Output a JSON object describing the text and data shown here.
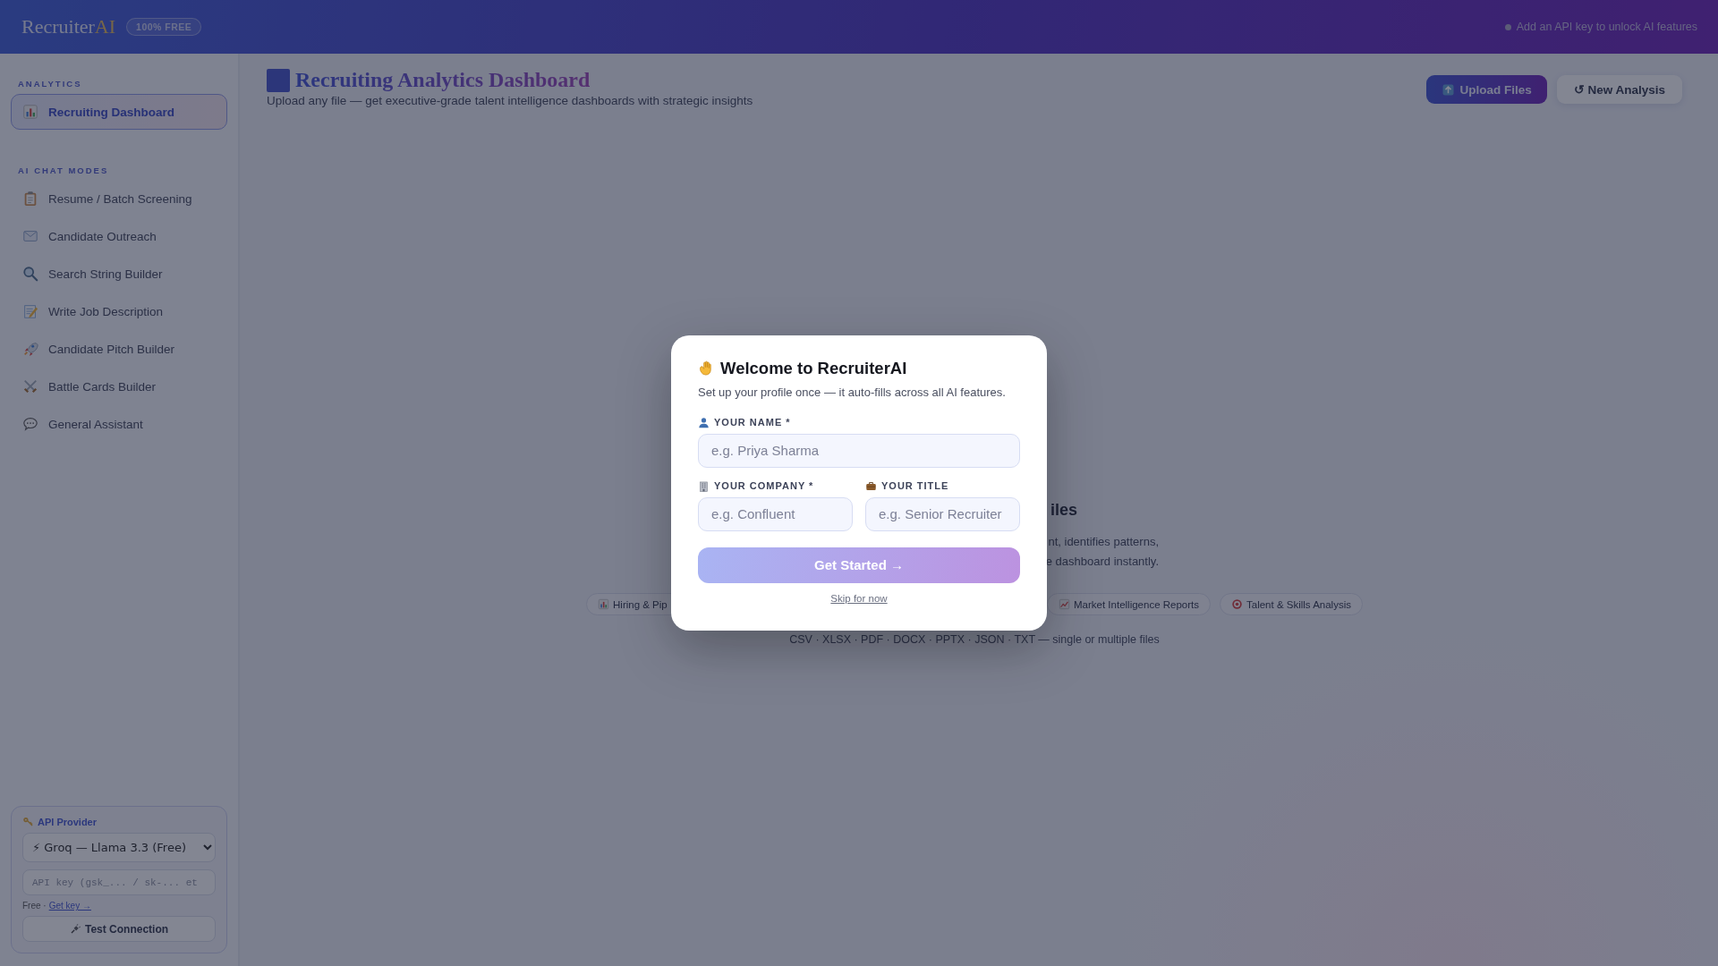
{
  "header": {
    "logo": {
      "text": "Recruiter",
      "accent": "AI"
    },
    "badge": "100% FREE",
    "status": "Add an API key to unlock AI features"
  },
  "sidebar": {
    "sections": [
      {
        "title": "ANALYTICS",
        "items": [
          {
            "label": "Recruiting Dashboard",
            "selected": true
          }
        ]
      },
      {
        "title": "AI CHAT MODES",
        "items": [
          {
            "label": "Resume / Batch Screening",
            "selected": false
          },
          {
            "label": "Candidate Outreach",
            "selected": false
          },
          {
            "label": "Search String Builder",
            "selected": false
          },
          {
            "label": "Write Job Description",
            "selected": false
          },
          {
            "label": "Candidate Pitch Builder",
            "selected": false
          },
          {
            "label": "Battle Cards Builder",
            "selected": false
          },
          {
            "label": "General Assistant",
            "selected": false
          }
        ]
      }
    ],
    "api_panel": {
      "title": "API Provider",
      "provider": "⚡ Groq — Llama 3.3 (Free)",
      "key_placeholder": "API key (gsk_... / sk-... et",
      "note": "Free ·",
      "link": "Get key →",
      "button": "Test Connection"
    }
  },
  "main": {
    "title": "Recruiting Analytics Dashboard",
    "subtitle": "Upload any file — get executive-grade talent intelligence dashboards with strategic insights",
    "buttons": [
      {
        "label": "Upload Files",
        "kind": "primary"
      },
      {
        "label": "↺ New Analysis",
        "kind": "secondary"
      }
    ],
    "empty_state": {
      "heading": "iles",
      "lines": [
        "nt, identifies patterns,",
        "e dashboard instantly."
      ],
      "chips": [
        "Hiring & Pip",
        "Market Intelligence Reports",
        "Talent & Skills Analysis"
      ],
      "formats": "CSV · XLSX · PDF · DOCX · PPTX · JSON · TXT — single or multiple files"
    }
  },
  "modal": {
    "title": "Welcome to RecruiterAI",
    "subtitle": "Set up your profile once — it auto-fills across all AI features.",
    "fields": [
      {
        "label": "YOUR NAME *",
        "placeholder": "e.g. Priya Sharma"
      },
      {
        "label": "YOUR COMPANY *",
        "placeholder": "e.g. Confluent"
      },
      {
        "label": "YOUR TITLE",
        "placeholder": "e.g. Senior Recruiter"
      }
    ],
    "button": "Get Started →",
    "skip": "Skip for now"
  }
}
